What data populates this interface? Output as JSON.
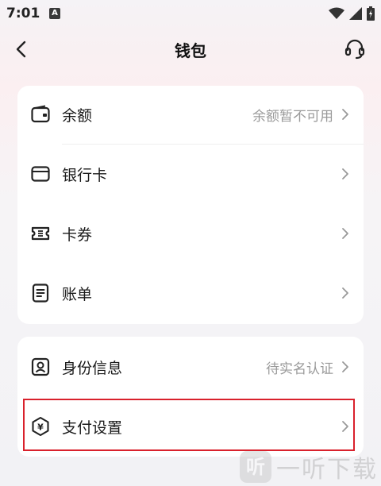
{
  "status_bar": {
    "time": "7:01",
    "notification_badge": "A"
  },
  "navbar": {
    "title": "钱包",
    "back_icon": "chevron-left-icon",
    "support_icon": "headset-icon"
  },
  "menu_group_1": [
    {
      "label": "余额",
      "right_text": "余额暂不可用",
      "icon": "wallet-icon"
    },
    {
      "label": "银行卡",
      "right_text": "",
      "icon": "bank-card-icon"
    },
    {
      "label": "卡券",
      "right_text": "",
      "icon": "coupon-icon"
    },
    {
      "label": "账单",
      "right_text": "",
      "icon": "bill-icon"
    }
  ],
  "menu_group_2": [
    {
      "label": "身份信息",
      "right_text": "待实名认证",
      "icon": "id-card-icon"
    },
    {
      "label": "支付设置",
      "right_text": "",
      "icon": "payment-settings-icon"
    }
  ],
  "highlight_color": "#d9212c",
  "watermark": {
    "logo_text": "听",
    "text": "一听下载"
  }
}
